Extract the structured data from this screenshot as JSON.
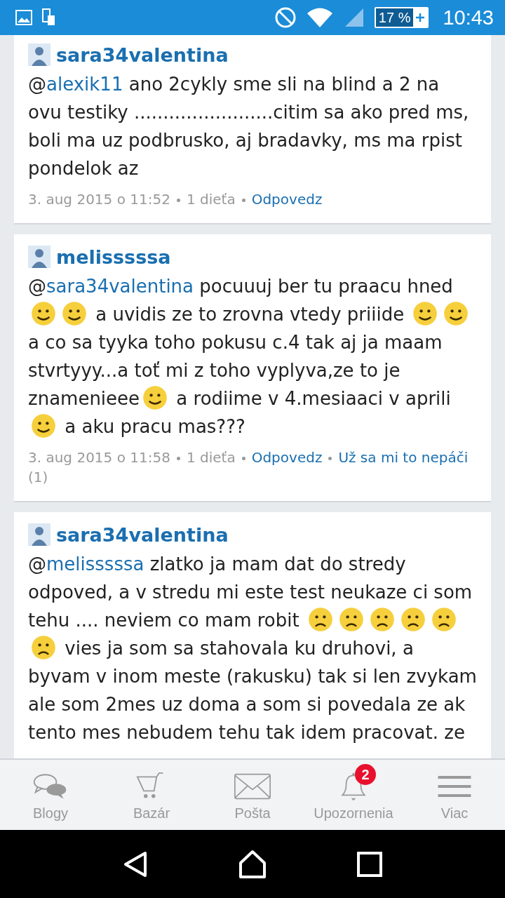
{
  "status_bar": {
    "battery": "17 %",
    "time": "10:43"
  },
  "posts": [
    {
      "author": "sara34valentina",
      "body": [
        {
          "kind": "text",
          "text": "@"
        },
        {
          "kind": "mention",
          "text": "alexik11"
        },
        {
          "kind": "text",
          "text": " ano 2cykly sme sli na blind a 2 na ovu testiky ........................citim sa ako pred ms, boli ma uz podbrusko, aj bradavky, ms ma rpist pondelok az"
        }
      ],
      "date": "3. aug 2015 o 11:52",
      "children": "1 dieťa",
      "actions": [
        {
          "label": "Odpovedz"
        }
      ]
    },
    {
      "author": "melisssssa",
      "body": [
        {
          "kind": "text",
          "text": "@"
        },
        {
          "kind": "mention",
          "text": "sara34valentina"
        },
        {
          "kind": "text",
          "text": " pocuuuj ber tu praacu hned "
        },
        {
          "kind": "smile"
        },
        {
          "kind": "smile"
        },
        {
          "kind": "text",
          "text": " a uvidis ze to zrovna vtedy priiide "
        },
        {
          "kind": "smile"
        },
        {
          "kind": "smile"
        },
        {
          "kind": "text",
          "text": "a co sa tyyka toho pokusu c.4 tak aj ja maam stvrtyyy...a toť mi z toho vyplyva,ze to je znamenieee"
        },
        {
          "kind": "smile"
        },
        {
          "kind": "text",
          "text": " a rodiime v 4.mesiaaci v aprili "
        },
        {
          "kind": "smile"
        },
        {
          "kind": "text",
          "text": " a aku pracu mas???"
        }
      ],
      "date": "3. aug 2015 o 11:58",
      "children": "1 dieťa",
      "actions": [
        {
          "label": "Odpovedz"
        },
        {
          "label": "Už sa mi to nepáči",
          "count": "(1)"
        }
      ]
    },
    {
      "author": "sara34valentina",
      "body": [
        {
          "kind": "text",
          "text": "@"
        },
        {
          "kind": "mention",
          "text": "melisssssa"
        },
        {
          "kind": "text",
          "text": " zlatko ja mam dat do stredy odpoved, a v stredu mi este test neukaze ci som tehu .... neviem co mam robit "
        },
        {
          "kind": "frown"
        },
        {
          "kind": "frown"
        },
        {
          "kind": "frown"
        },
        {
          "kind": "frown"
        },
        {
          "kind": "frown"
        },
        {
          "kind": "frown"
        },
        {
          "kind": "text",
          "text": " vies ja som sa stahovala ku druhovi, a byvam v inom meste (rakusku) tak si len zvykam ale som 2mes uz doma a som si povedala ze ak tento mes nebudem tehu tak idem pracovat. ze"
        }
      ]
    }
  ],
  "bottom_nav": [
    {
      "kind": "chat",
      "label": "Blogy"
    },
    {
      "kind": "cart",
      "label": "Bazár"
    },
    {
      "kind": "mail",
      "label": "Pošta"
    },
    {
      "kind": "bell",
      "label": "Upozornenia",
      "badge": "2"
    },
    {
      "kind": "menu",
      "label": "Viac"
    }
  ]
}
